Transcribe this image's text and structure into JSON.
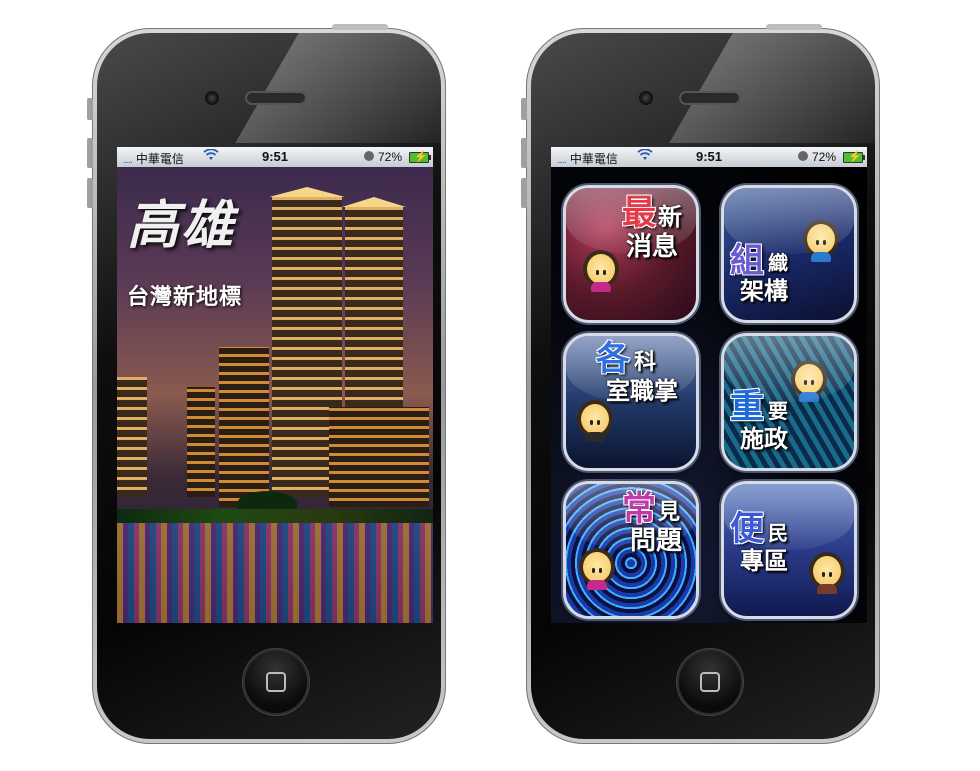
{
  "status_bar": {
    "carrier": "中華電信",
    "signal": ".....",
    "time": "9:51",
    "battery": "72%"
  },
  "splash": {
    "title": "高雄",
    "subtitle": "台灣新地標"
  },
  "menu": {
    "tiles": [
      {
        "big": "最",
        "small1": "新",
        "small2": "消息",
        "color": "#e33b4a"
      },
      {
        "big": "組",
        "small1": "織",
        "small2": "架構",
        "color": "#6a5ad0"
      },
      {
        "big": "各",
        "small1": "科",
        "small2": "室職掌",
        "color": "#2f6fe0"
      },
      {
        "big": "重",
        "small1": "要",
        "small2": "施政",
        "color": "#1f6ad8"
      },
      {
        "big": "常",
        "small1": "見",
        "small2": "問題",
        "color": "#c23aa8"
      },
      {
        "big": "便",
        "small1": "民",
        "small2": "專區",
        "color": "#3a5ad8"
      }
    ]
  },
  "icons": [
    "signal-icon",
    "wifi-icon",
    "lock-rotation-icon",
    "battery-icon",
    "home-button-icon",
    "mascot-icon"
  ]
}
